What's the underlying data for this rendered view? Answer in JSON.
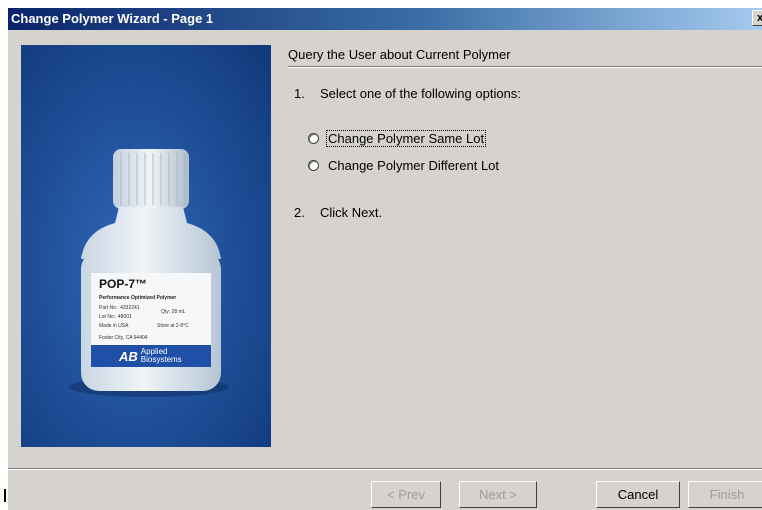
{
  "window": {
    "title": "Change Polymer Wizard - Page 1",
    "close_glyph": "x"
  },
  "image": {
    "brand_line": "POP-7™",
    "product_line": "Performance Optimized Polymer",
    "part_no": "Part No.: 4332241",
    "lot_no": "Lot No.: 48001",
    "made_in": "Made in USA",
    "city": "Foster City, CA 94404",
    "store_at": "Store at 2-8°C",
    "qty": "Qty: 28 mL",
    "logo_mark": "AB",
    "logo_text_1": "Applied",
    "logo_text_2": "Biosystems"
  },
  "content": {
    "header": "Query the User about Current Polymer",
    "step1": {
      "num": "1.",
      "text": "Select one of the following options:"
    },
    "options": [
      {
        "label": "Change Polymer Same Lot",
        "selected": false,
        "focused": true
      },
      {
        "label": "Change Polymer Different Lot",
        "selected": false,
        "focused": false
      }
    ],
    "step2": {
      "num": "2.",
      "text": "Click Next."
    }
  },
  "buttons": {
    "prev": "< Prev",
    "next": "Next >",
    "cancel": "Cancel",
    "finish": "Finish"
  }
}
